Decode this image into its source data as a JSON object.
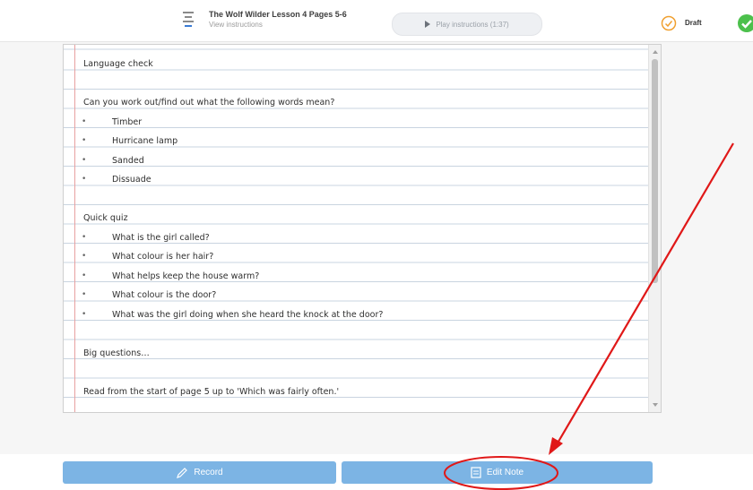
{
  "header": {
    "title": "The Wolf Wilder Lesson 4 Pages 5-6",
    "subtitle": "View instructions",
    "play_label": "Play instructions (1:37)",
    "status_label": "Draft"
  },
  "note": {
    "lines": [
      {
        "text": "Language check",
        "bullet": false
      },
      {
        "text": "",
        "bullet": false
      },
      {
        "text": "Can you work out/find out what the following words mean?",
        "bullet": false
      },
      {
        "text": "Timber",
        "bullet": true
      },
      {
        "text": "Hurricane lamp",
        "bullet": true
      },
      {
        "text": "Sanded",
        "bullet": true
      },
      {
        "text": "Dissuade",
        "bullet": true
      },
      {
        "text": "",
        "bullet": false
      },
      {
        "text": "Quick quiz",
        "bullet": false
      },
      {
        "text": "What is the girl called?",
        "bullet": true
      },
      {
        "text": "What colour is her hair?",
        "bullet": true
      },
      {
        "text": "What helps keep the house warm?",
        "bullet": true
      },
      {
        "text": "What colour is the door?",
        "bullet": true
      },
      {
        "text": "What was the girl doing when she heard the knock at the door?",
        "bullet": true
      },
      {
        "text": "",
        "bullet": false
      },
      {
        "text": "Big questions…",
        "bullet": false
      },
      {
        "text": "",
        "bullet": false
      },
      {
        "text": "Read from the start of page 5 up to 'Which was fairly often.'",
        "bullet": false
      }
    ]
  },
  "actions": {
    "record_label": "Record",
    "edit_note_label": "Edit Note"
  },
  "colors": {
    "button_blue": "#7cb4e4",
    "annotation_red": "#e01818",
    "draft_orange": "#f0a030",
    "submitted_green": "#4cc04c"
  },
  "icons": [
    "document-icon",
    "play-icon",
    "draft-clock-icon",
    "checkmark-icon",
    "pencil-icon",
    "note-icon"
  ]
}
